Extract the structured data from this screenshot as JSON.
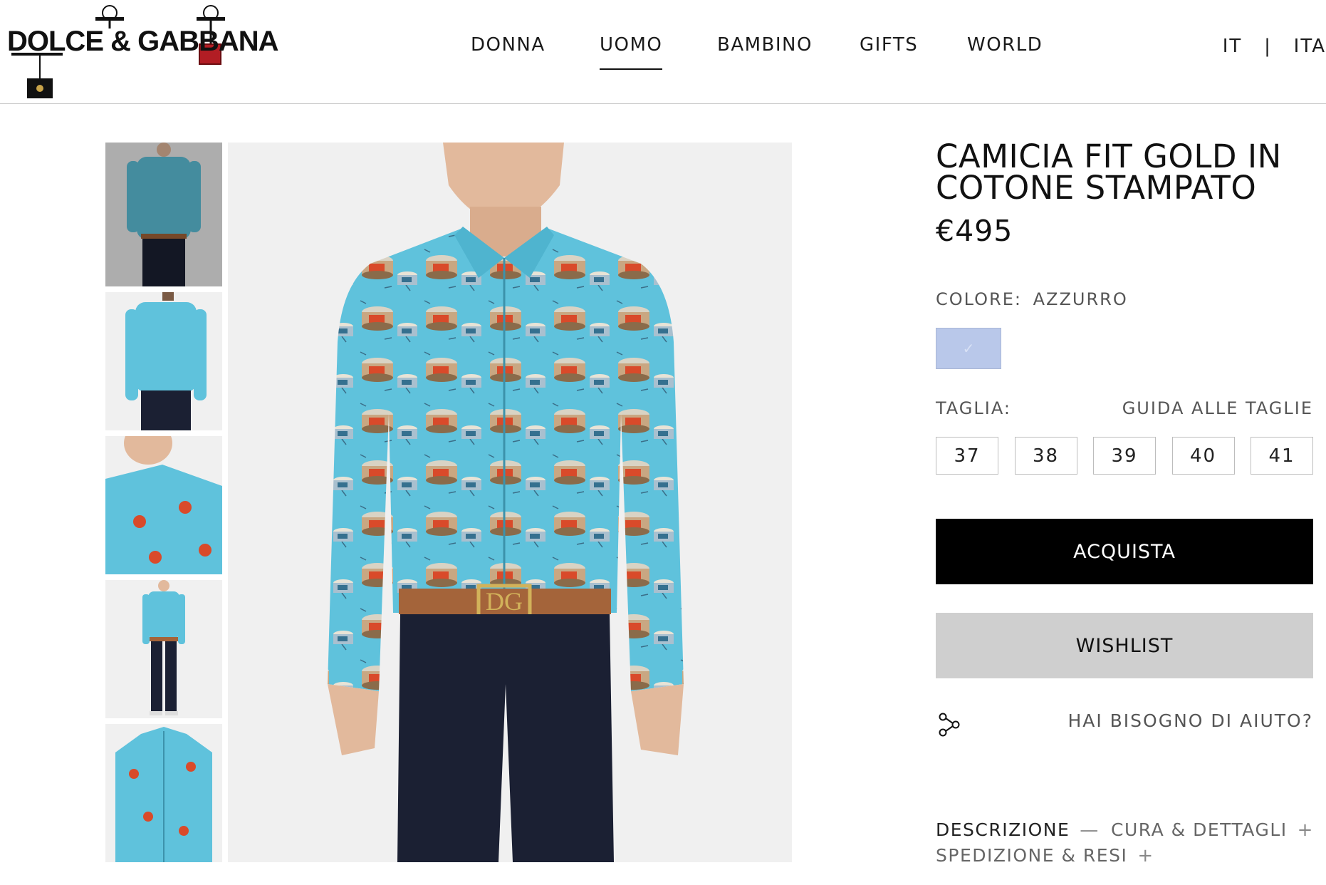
{
  "logo": {
    "text": "DOLCE & GABBANA"
  },
  "nav": [
    {
      "label": "DONNA",
      "active": false
    },
    {
      "label": "UOMO",
      "active": true
    },
    {
      "label": "BAMBINO",
      "active": false
    },
    {
      "label": "GIFTS",
      "active": false
    },
    {
      "label": "WORLD",
      "active": false
    }
  ],
  "language": {
    "country": "IT",
    "separator": "|",
    "lang": "ITA"
  },
  "product": {
    "title_line1": "CAMICIA FIT GOLD IN",
    "title_line2": "COTONE STAMPATO",
    "price": "€495",
    "color_label": "COLORE:",
    "color_value": "AZZURRO",
    "swatch_color": "#b9c8ea",
    "size_label": "TAGLIA:",
    "size_guide": "GUIDA ALLE TAGLIE",
    "sizes": [
      "37",
      "38",
      "39",
      "40",
      "41"
    ],
    "buy_label": "ACQUISTA",
    "wishlist_label": "WISHLIST",
    "help_label": "HAI BISOGNO DI AIUTO?"
  },
  "tabs": [
    {
      "label": "DESCRIZIONE",
      "sign": "—"
    },
    {
      "label": "CURA & DETTAGLI",
      "sign": "+"
    },
    {
      "label": "SPEDIZIONE & RESI",
      "sign": "+"
    }
  ],
  "icons": {
    "share": "share-icon",
    "check": "checkmark-icon"
  },
  "colors": {
    "shirt": "#5fc2dc",
    "jeans": "#1b2033",
    "belt": "#a4643a",
    "buy_button": "#000000",
    "wishlist_button": "#cfcfcf"
  },
  "thumbnails": [
    "front-view",
    "back-view",
    "detail-view",
    "full-length-view",
    "flat-view"
  ]
}
